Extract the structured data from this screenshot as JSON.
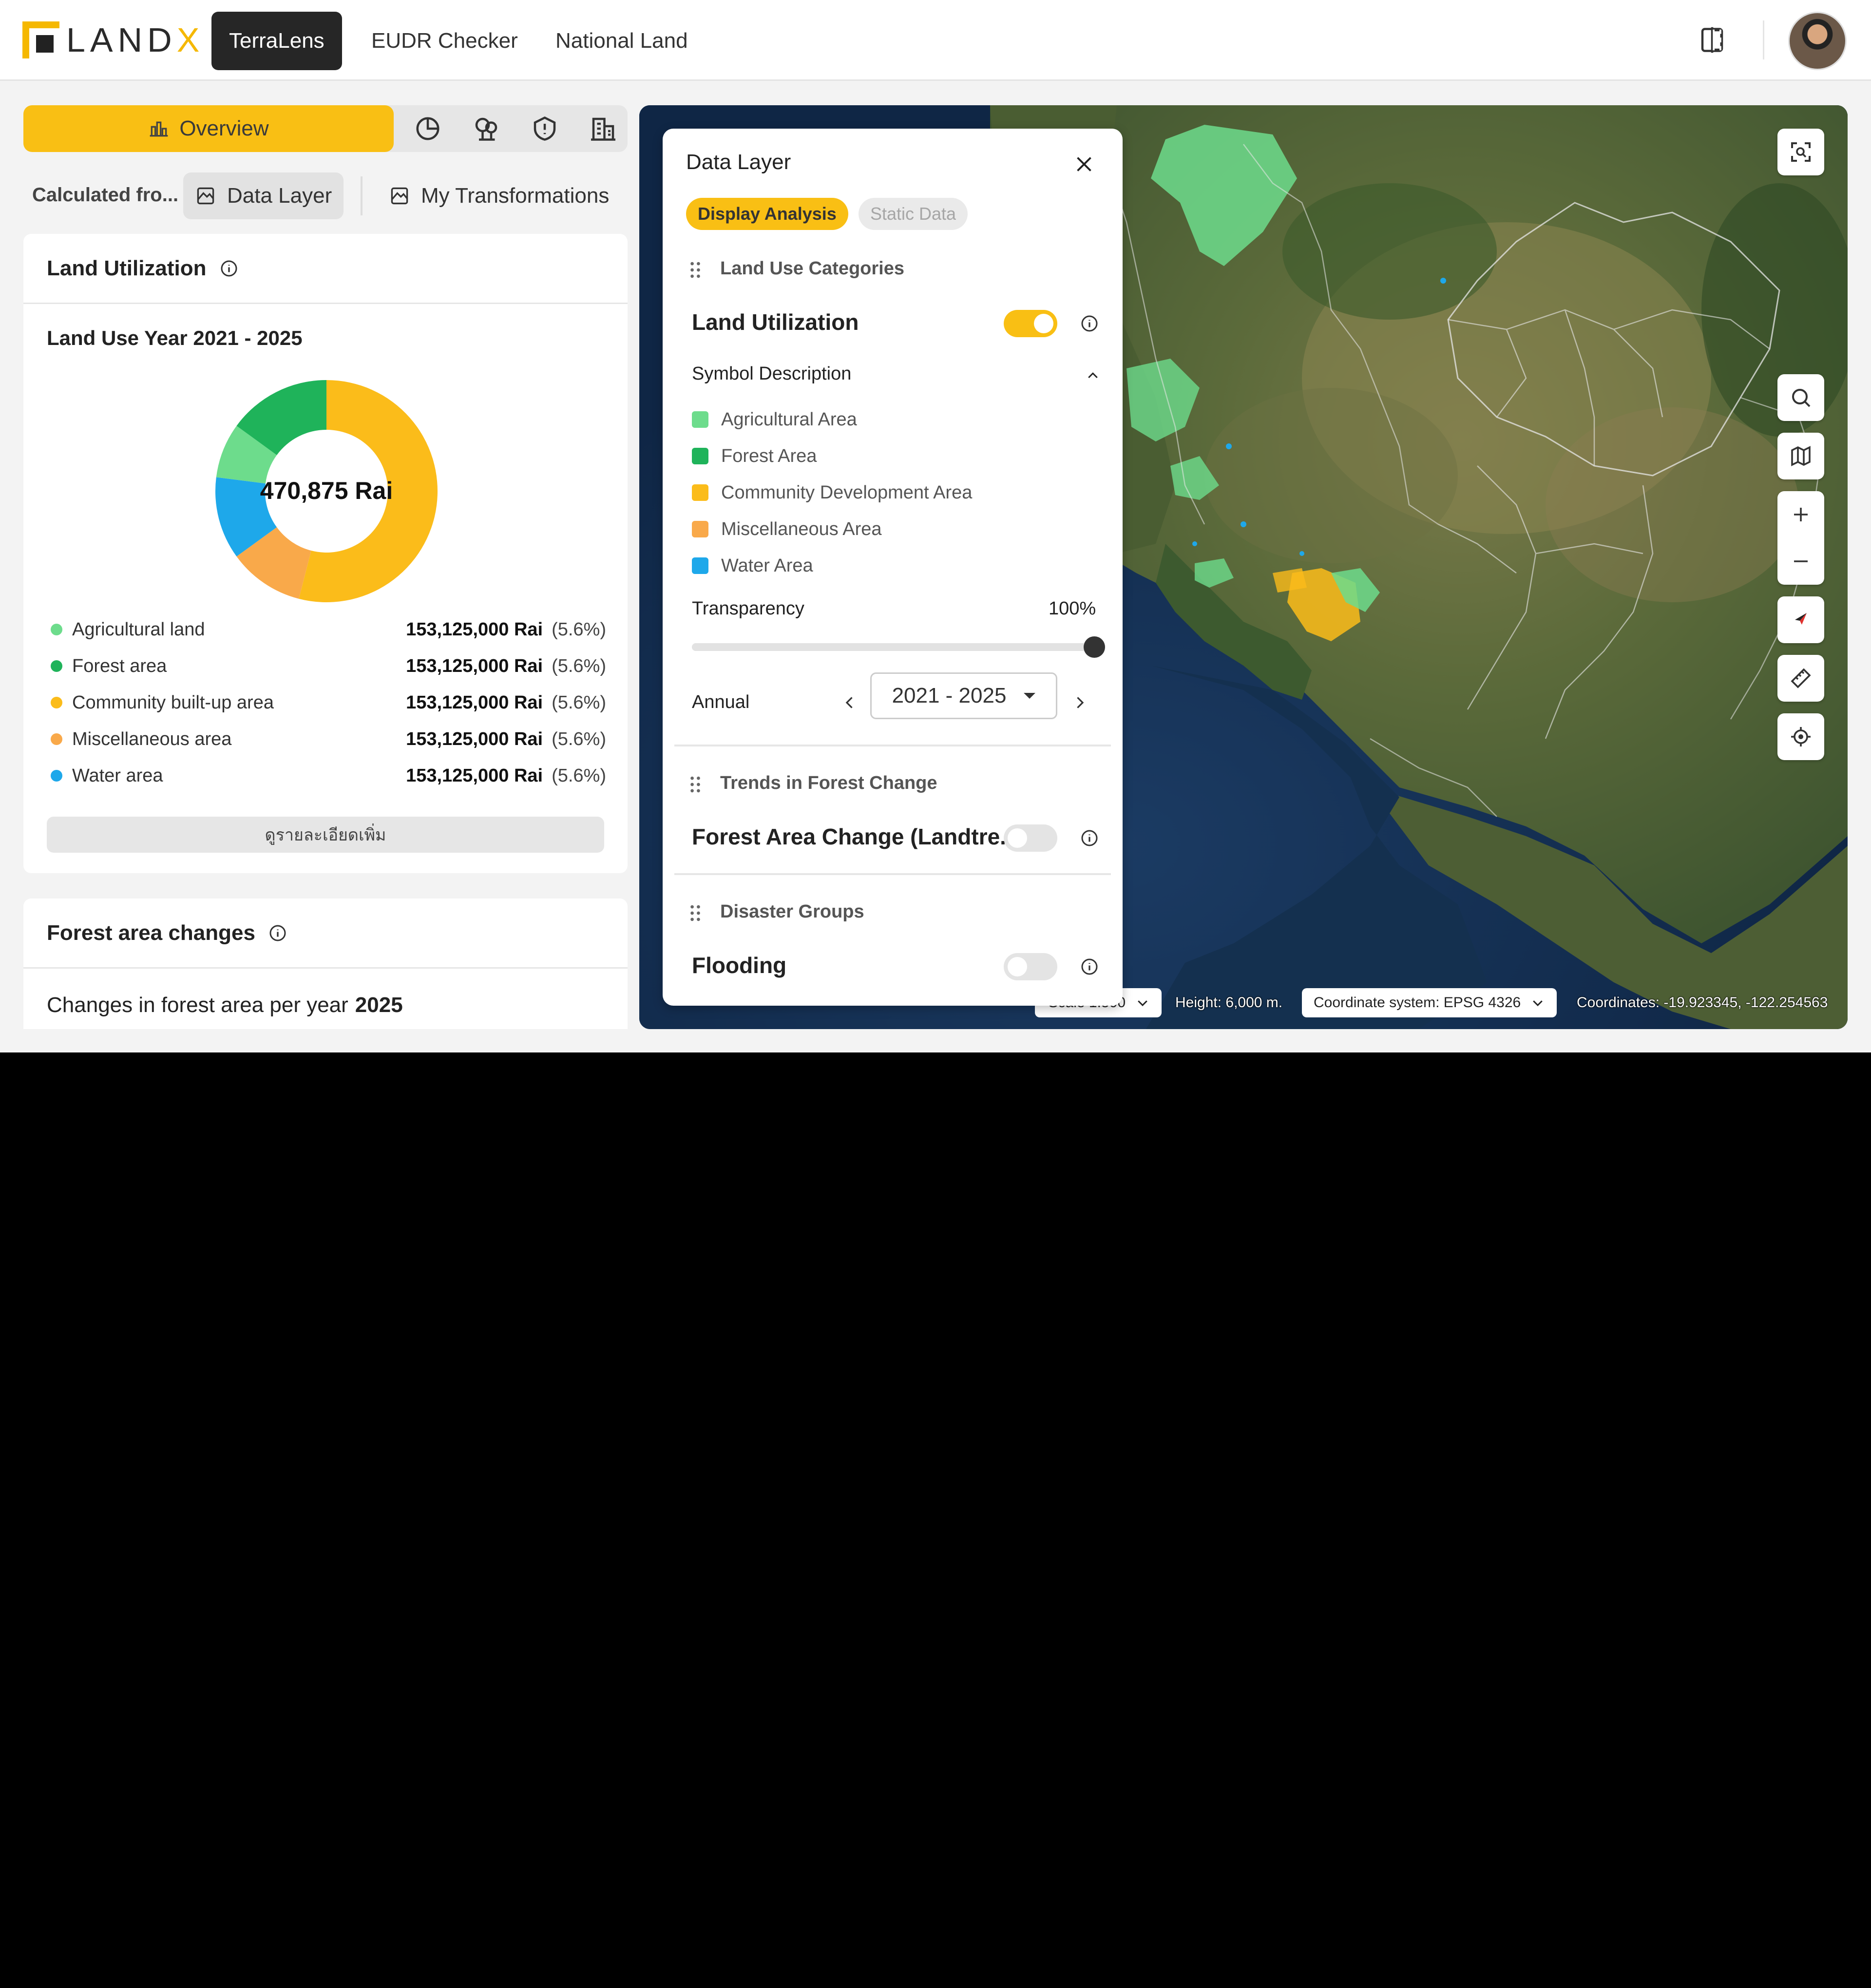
{
  "header": {
    "logo_text_main": "LAND",
    "logo_text_accent": "X",
    "nav": [
      {
        "label": "TerraLens",
        "active": true
      },
      {
        "label": "EUDR Checker",
        "active": false
      },
      {
        "label": "National Land",
        "active": false
      }
    ],
    "icons": [
      "split-view-icon",
      "avatar"
    ]
  },
  "left_panel": {
    "tabs": {
      "overview_label": "Overview",
      "icon_tabs": [
        "pie-chart-icon",
        "forest-icon",
        "shield-alert-icon",
        "building-icon"
      ]
    },
    "source": {
      "label": "Calculated fro...",
      "data_layer_label": "Data Layer",
      "transformations_label": "My Transformations"
    },
    "land_utilization": {
      "title": "Land Utilization",
      "subtitle": "Land Use Year 2021 - 2025",
      "center_total": "470,875 Rai",
      "items": [
        {
          "name": "Agricultural land",
          "value": "153,125,000 Rai",
          "pct": "(5.6%)",
          "color": "#6ddc8c"
        },
        {
          "name": "Forest area",
          "value": "153,125,000 Rai",
          "pct": "(5.6%)",
          "color": "#1fb35a"
        },
        {
          "name": "Community built-up area",
          "value": "153,125,000 Rai",
          "pct": "(5.6%)",
          "color": "#fbbc1a"
        },
        {
          "name": "Miscellaneous area",
          "value": "153,125,000 Rai",
          "pct": "(5.6%)",
          "color": "#f9a94a"
        },
        {
          "name": "Water area",
          "value": "153,125,000 Rai",
          "pct": "(5.6%)",
          "color": "#1ea8ea"
        }
      ],
      "more_label": "ดูรายละเอียดเพิ่ม"
    },
    "forest_changes": {
      "title": "Forest area changes",
      "subtitle_prefix": "Changes in forest area per year",
      "subtitle_year": "2025"
    }
  },
  "chart_data": {
    "type": "pie",
    "categories": [
      "Agricultural land",
      "Forest area",
      "Community built-up area",
      "Miscellaneous area",
      "Water area"
    ],
    "values": [
      8,
      15,
      54,
      11,
      12
    ],
    "colors": [
      "#6ddc8c",
      "#1fb35a",
      "#fbbc1a",
      "#f9a94a",
      "#1ea8ea"
    ],
    "title": "Land Use Year 2021 - 2025"
  },
  "data_layer": {
    "title": "Data Layer",
    "chips": {
      "active": "Display Analysis",
      "inactive": "Static Data"
    },
    "groups": {
      "land_use": "Land Use Categories",
      "forest_trends": "Trends in Forest Change",
      "disaster": "Disaster Groups"
    },
    "layers": {
      "land_utilization": {
        "label": "Land Utilization",
        "enabled": true
      },
      "forest_change": {
        "label": "Forest Area Change (Landtre...",
        "enabled": false
      },
      "flooding": {
        "label": "Flooding",
        "enabled": false
      }
    },
    "symbol_header": "Symbol Description",
    "symbols": [
      {
        "label": "Agricultural Area",
        "color": "#6ddc8c"
      },
      {
        "label": "Forest Area",
        "color": "#1fb35a"
      },
      {
        "label": "Community Development Area",
        "color": "#fbbc1a"
      },
      {
        "label": "Miscellaneous Area",
        "color": "#f9a94a"
      },
      {
        "label": "Water Area",
        "color": "#1ea8ea"
      }
    ],
    "transparency": {
      "label": "Transparency",
      "value_text": "100%",
      "value": 1.0
    },
    "annual": {
      "label": "Annual",
      "value": "2021 - 2025"
    }
  },
  "map": {
    "scale_label": "Scale 1:500",
    "height_label": "Height: 6,000 m.",
    "coord_system_label": "Coordinate system: EPSG 4326",
    "coordinates_label": "Coordinates: -19.923345, -122.254563",
    "controls": [
      "fullscreen-icon",
      "search-icon",
      "map-icon",
      "zoom-in-icon",
      "zoom-out-icon",
      "compass-icon",
      "ruler-icon",
      "locate-icon"
    ]
  }
}
